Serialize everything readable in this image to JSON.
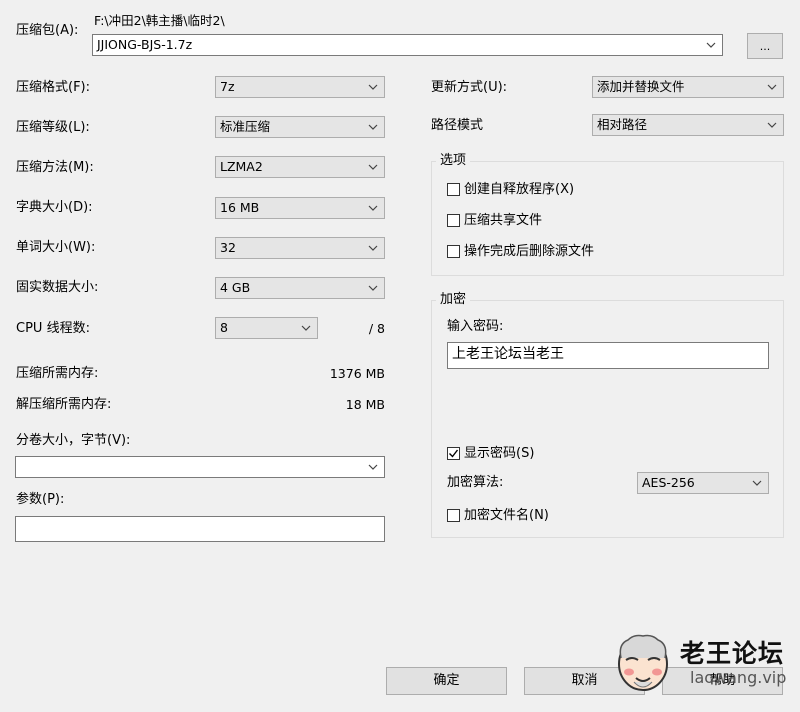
{
  "archive": {
    "label": "压缩包(A):",
    "path": "F:\\冲田2\\韩主播\\临时2\\",
    "name": "JJIONG-BJS-1.7z",
    "browse_label": "..."
  },
  "left": {
    "format": {
      "label": "压缩格式(F):",
      "value": "7z"
    },
    "level": {
      "label": "压缩等级(L):",
      "value": "标准压缩"
    },
    "method": {
      "label": "压缩方法(M):",
      "value": "LZMA2"
    },
    "dict": {
      "label": "字典大小(D):",
      "value": "16 MB"
    },
    "word": {
      "label": "单词大小(W):",
      "value": "32"
    },
    "solid": {
      "label": "固实数据大小:",
      "value": "4 GB"
    },
    "threads": {
      "label": "CPU 线程数:",
      "value": "8",
      "max": "/ 8"
    },
    "mem_compress": {
      "label": "压缩所需内存:",
      "value": "1376 MB"
    },
    "mem_decompress": {
      "label": "解压缩所需内存:",
      "value": "18 MB"
    },
    "volume": {
      "label": "分卷大小，字节(V):",
      "value": ""
    },
    "params": {
      "label": "参数(P):",
      "value": ""
    }
  },
  "right": {
    "update": {
      "label": "更新方式(U):",
      "value": "添加并替换文件"
    },
    "pathmode": {
      "label": "路径模式",
      "value": "相对路径"
    },
    "options": {
      "title": "选项",
      "sfx": {
        "label": "创建自释放程序(X)",
        "checked": false
      },
      "shared": {
        "label": "压缩共享文件",
        "checked": false
      },
      "delete": {
        "label": "操作完成后删除源文件",
        "checked": false
      }
    },
    "encryption": {
      "title": "加密",
      "password_label": "输入密码:",
      "password": "上老王论坛当老王",
      "show_password": {
        "label": "显示密码(S)",
        "checked": true
      },
      "method_label": "加密算法:",
      "method": "AES-256",
      "encrypt_names": {
        "label": "加密文件名(N)",
        "checked": false
      }
    }
  },
  "buttons": {
    "ok": "确定",
    "cancel": "取消",
    "help": "帮助"
  },
  "watermark": {
    "title": "老王论坛",
    "url": "laowang.vip"
  }
}
